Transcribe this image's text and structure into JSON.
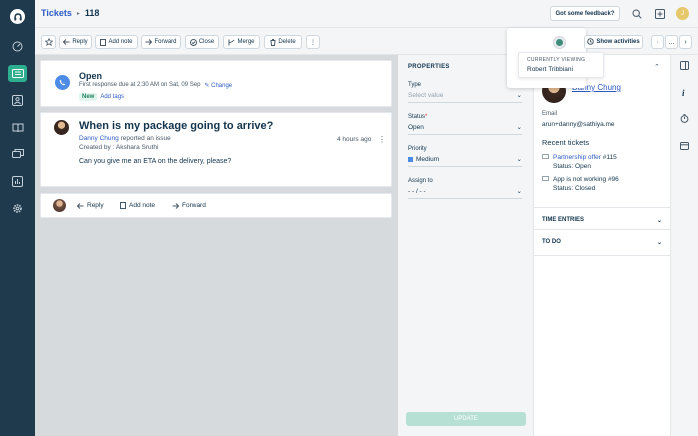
{
  "breadcrumb": {
    "parent": "Tickets",
    "separator": "▸",
    "current": "118"
  },
  "header": {
    "feedback_label": "Got some feedback?",
    "avatar_initial": "J"
  },
  "toolbar": {
    "reply": "Reply",
    "add_note": "Add note",
    "forward": "Forward",
    "close": "Close",
    "merge": "Merge",
    "delete": "Delete",
    "more": "⋮",
    "show_activities": "Show activities",
    "prev": "‹",
    "menu": "…",
    "next": "›"
  },
  "viewing": {
    "label": "CURRENTLY VIEWING",
    "name": "Robert Tribbiani"
  },
  "ticket": {
    "status": "Open",
    "due_text": "First response due at 2:30 AM on Sat, 09 Sep",
    "change_label": "Change",
    "tag": "New",
    "add_tags": "Add tags",
    "subject": "When is my package going to arrive?",
    "requester": "Danny Chung",
    "reported": "reported an issue",
    "created_by": "Created by : Akshara Sruthi",
    "time": "4 hours ago",
    "body": "Can you give me an ETA on the delivery, please?"
  },
  "reply_bar": {
    "reply": "Reply",
    "add_note": "Add note",
    "forward": "Forward"
  },
  "properties": {
    "title": "PROPERTIES",
    "type_label": "Type",
    "type_placeholder": "Select value",
    "status_label": "Status",
    "required_mark": "*",
    "status_value": "Open",
    "priority_label": "Priority",
    "priority_value": "Medium",
    "assign_label": "Assign to",
    "assign_value": "- - / - -",
    "update_label": "UPDATE"
  },
  "contact": {
    "name": "Danny Chung",
    "email_label": "Email",
    "email": "arun+danny@sathiya.me",
    "recent_label": "Recent tickets",
    "recent": [
      {
        "title": "Partnership offer",
        "id": "#115",
        "status": "Status: Open"
      },
      {
        "title": "App is not working",
        "id": "#96",
        "status": "Status: Closed"
      }
    ],
    "time_entries": "TIME ENTRIES",
    "todo": "TO DO"
  },
  "colors": {
    "rail": "#1f3a4d",
    "accent": "#2dae8f",
    "link": "#2c5cc5",
    "priority": "#4c8ce6"
  }
}
